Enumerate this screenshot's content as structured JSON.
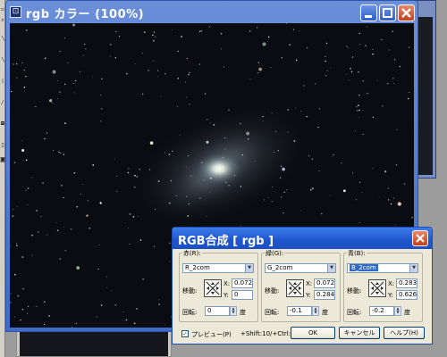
{
  "image_window": {
    "title": "rgb カラー (100%)",
    "icon": "app-window-icon"
  },
  "dialog": {
    "title": "RGB合成 [ rgb ]",
    "channels": [
      {
        "key": "red",
        "label": "赤(R):",
        "source": "R_2com",
        "move_label": "移動:",
        "x_label": "X:",
        "x": "0.0724",
        "y_label": "Y:",
        "y": "0",
        "rotate_label": "回転:",
        "rotate": "0",
        "unit": "度"
      },
      {
        "key": "green",
        "label": "緑(G):",
        "source": "G_2com",
        "move_label": "移動:",
        "x_label": "X:",
        "x": "0.0724",
        "y_label": "Y:",
        "y": "0.2842",
        "rotate_label": "回転:",
        "rotate": "-0.1",
        "unit": "度"
      },
      {
        "key": "blue",
        "label": "青(B):",
        "source": "B_2com",
        "move_label": "移動:",
        "x_label": "X:",
        "x": "0.2838",
        "y_label": "Y:",
        "y": "0.6261",
        "rotate_label": "回転:",
        "rotate": "-0.2",
        "unit": "度"
      }
    ],
    "preview_label": "プレビュー(P)",
    "preview_checked": true,
    "hint": "+Shift:10/+Ctrl:C",
    "ok_label": "OK",
    "cancel_label": "キャンセル",
    "help_label": "ヘルプ(H)"
  },
  "colors": {
    "titlebar_blue": "#1f55cc",
    "close_red": "#c43f1c",
    "dialog_face": "#ece9d8",
    "night_sky": "#0b0c12"
  }
}
